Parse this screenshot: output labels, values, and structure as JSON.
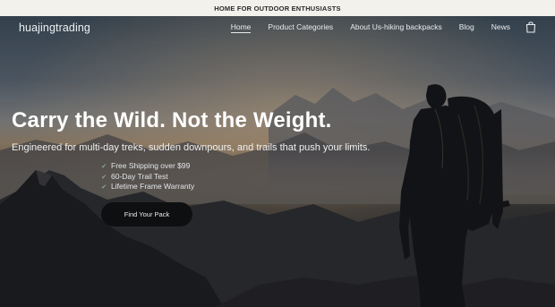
{
  "announcement": {
    "text": "HOME FOR OUTDOOR ENTHUSIASTS"
  },
  "header": {
    "logo": "huajingtrading",
    "nav": [
      {
        "label": "Home",
        "active": true
      },
      {
        "label": "Product Categories",
        "active": false
      },
      {
        "label": "About Us-hiking backpacks",
        "active": false
      },
      {
        "label": "Blog",
        "active": false
      },
      {
        "label": "News",
        "active": false
      }
    ],
    "cart_icon": "shopping-bag-icon"
  },
  "hero": {
    "title": "Carry the Wild. Not the Weight.",
    "subtitle": "Engineered for multi-day treks, sudden downpours, and trails that push your limits.",
    "perks": [
      "Free Shipping over $99",
      "60-Day Trail Test",
      "Lifetime Frame Warranty"
    ],
    "perk_icon": "check-icon",
    "cta_label": "Find Your Pack",
    "background": "mountain-hiker-photo"
  },
  "colors": {
    "announcement_bg": "#f3f1ec",
    "cta_bg": "#0e0f11",
    "text_light": "#ffffff"
  }
}
